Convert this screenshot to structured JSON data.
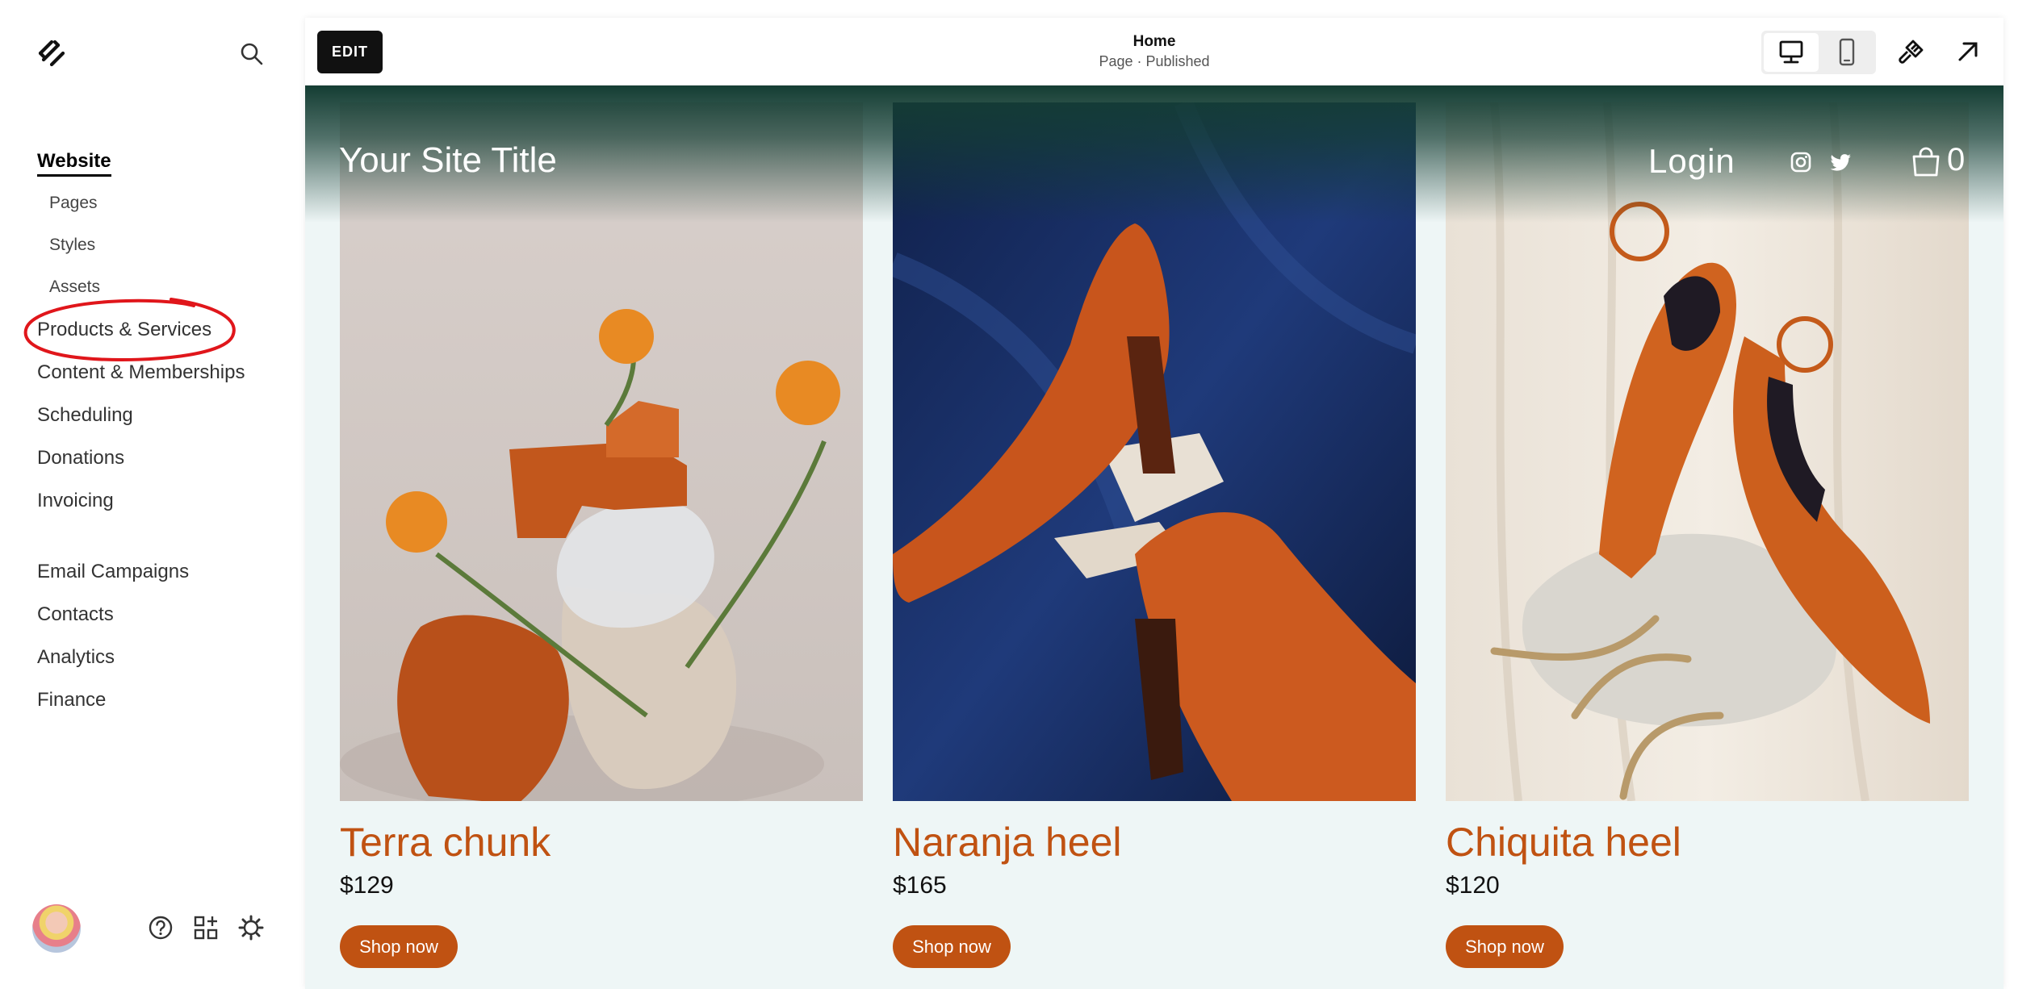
{
  "sidebar": {
    "logo": "squarespace-logo",
    "search_icon": "search-icon",
    "website_label": "Website",
    "sub_items": [
      {
        "label": "Pages"
      },
      {
        "label": "Styles"
      },
      {
        "label": "Assets"
      }
    ],
    "main_items": [
      {
        "label": "Products & Services"
      },
      {
        "label": "Content & Memberships"
      },
      {
        "label": "Scheduling"
      },
      {
        "label": "Donations"
      },
      {
        "label": "Invoicing"
      }
    ],
    "secondary_items": [
      {
        "label": "Email Campaigns"
      },
      {
        "label": "Contacts"
      },
      {
        "label": "Analytics"
      },
      {
        "label": "Finance"
      }
    ],
    "annotation_color": "#e0161b",
    "footer_icons": [
      "help-icon",
      "apps-icon",
      "settings-icon"
    ]
  },
  "toolbar": {
    "edit_label": "EDIT",
    "page_name": "Home",
    "page_status": "Page · Published",
    "device_modes": [
      "desktop-icon",
      "mobile-icon"
    ],
    "icons": [
      "design-brush-icon",
      "open-external-icon"
    ]
  },
  "site": {
    "title": "Your Site Title",
    "login_label": "Login",
    "social_icons": [
      "instagram-icon",
      "twitter-icon"
    ],
    "cart_count": "0",
    "accent_color": "#c05212",
    "header_color": "#143d33",
    "background_color": "#eef6f6"
  },
  "products": [
    {
      "name": "Terra chunk",
      "price": "$129",
      "button_label": "Shop now"
    },
    {
      "name": "Naranja heel",
      "price": "$165",
      "button_label": "Shop now"
    },
    {
      "name": "Chiquita heel",
      "price": "$120",
      "button_label": "Shop now"
    }
  ]
}
